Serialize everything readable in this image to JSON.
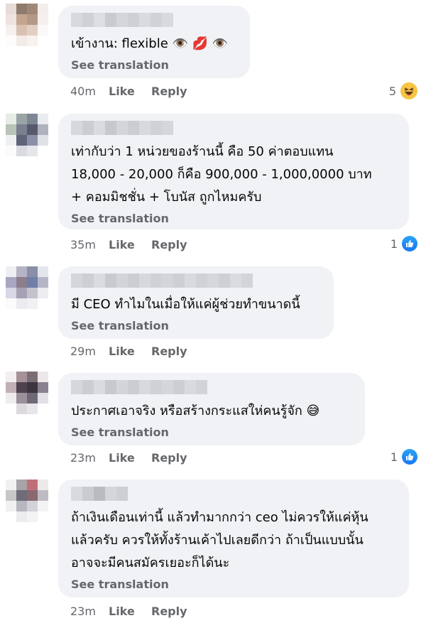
{
  "comments": [
    {
      "text_lines": [
        "เข้างาน: flexible 👁️ 💋 👁️"
      ],
      "see_translation": "See translation",
      "time": "40m",
      "like": "Like",
      "reply": "Reply",
      "reaction_count": "5",
      "reaction_icon": "haha-icon"
    },
    {
      "text_lines": [
        "เท่ากับว่า 1 หน่วยของร้านนี้ คือ 50 ค่าตอบแทน",
        "18,000 - 20,000 ก็คือ 900,000 - 1,000,0000 บาท",
        "+ คอมมิชชั่น + โบนัส ถูกไหมครับ"
      ],
      "see_translation": "See translation",
      "time": "35m",
      "like": "Like",
      "reply": "Reply",
      "reaction_count": "1",
      "reaction_icon": "like-icon"
    },
    {
      "text_lines": [
        "มี CEO ทำไมในเมื่อให้แค่ผู้ช่วยทำขนาดนี้"
      ],
      "see_translation": "See translation",
      "time": "29m",
      "like": "Like",
      "reply": "Reply",
      "reaction_count": "",
      "reaction_icon": ""
    },
    {
      "text_lines": [
        "ประกาศเอาจริง  หรือสร้างกระแสให่คนรู้จัก 😅"
      ],
      "see_translation": "See translation",
      "time": "23m",
      "like": "Like",
      "reply": "Reply",
      "reaction_count": "1",
      "reaction_icon": "like-icon"
    },
    {
      "text_lines": [
        "ถ้าเงินเดือนเท่านี้ แล้วทำมากกว่า ceo ไม่ควรให้แค่หุ้น",
        "แล้วครับ ควรให้ทั้งร้านเค้าไปเลยดีกว่า ถ้าเป็นแบบนั้น",
        "อาจจะมีคนสมัครเยอะก็ได้นะ"
      ],
      "see_translation": "See translation",
      "time": "23m",
      "like": "Like",
      "reply": "Reply",
      "reaction_count": "",
      "reaction_icon": ""
    }
  ],
  "colors": {
    "bubble": "#f0f2f5",
    "meta": "#65676b",
    "like_blue": "#1877f2"
  }
}
